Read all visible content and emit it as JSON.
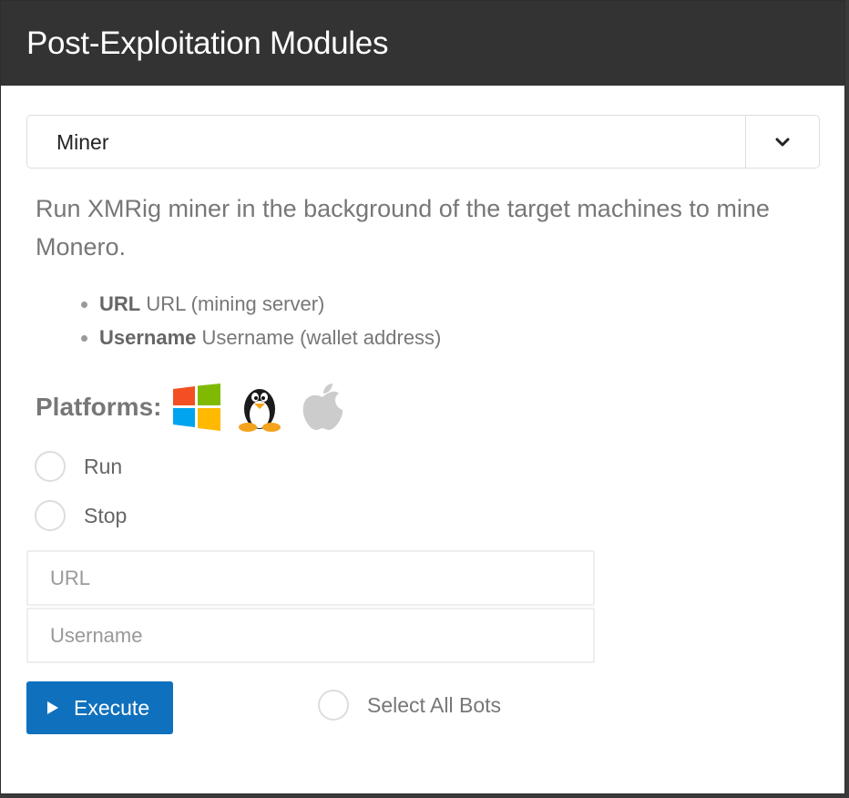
{
  "header": {
    "title": "Post-Exploitation Modules"
  },
  "module_select": {
    "selected": "Miner"
  },
  "description": "Run XMRig miner in the background of the target machines to mine Monero.",
  "options": [
    {
      "name": "URL",
      "desc": "URL (mining server)"
    },
    {
      "name": "Username",
      "desc": "Username (wallet address)"
    }
  ],
  "platforms": {
    "label": "Platforms:",
    "icons": [
      "windows-icon",
      "linux-icon",
      "apple-icon"
    ]
  },
  "actions": [
    {
      "label": "Run",
      "selected": false
    },
    {
      "label": "Stop",
      "selected": false
    }
  ],
  "inputs": {
    "url": {
      "placeholder": "URL",
      "value": ""
    },
    "username": {
      "placeholder": "Username",
      "value": ""
    }
  },
  "execute_button": {
    "label": "Execute"
  },
  "select_all": {
    "label": "Select All Bots",
    "selected": false
  },
  "colors": {
    "header_bg": "#333333",
    "accent": "#0f71bd",
    "muted_text": "#777777"
  }
}
